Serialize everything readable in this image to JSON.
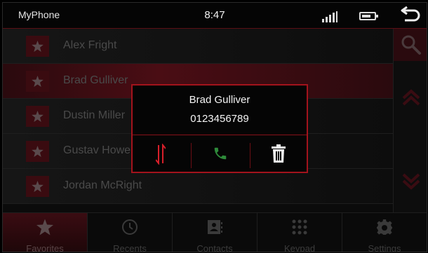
{
  "status": {
    "app_name": "MyPhone",
    "time": "8:47"
  },
  "contacts": [
    {
      "name": "Alex Fright"
    },
    {
      "name": "Brad Gulliver"
    },
    {
      "name": "Dustin Miller"
    },
    {
      "name": "Gustav Howe"
    },
    {
      "name": "Jordan McRight"
    }
  ],
  "dialog": {
    "name": "Brad Gulliver",
    "number": "0123456789"
  },
  "nav": [
    {
      "label": "Favorites",
      "icon": "star-icon"
    },
    {
      "label": "Recents",
      "icon": "clock-icon"
    },
    {
      "label": "Contacts",
      "icon": "contact-card-icon"
    },
    {
      "label": "Keypad",
      "icon": "keypad-icon"
    },
    {
      "label": "Settings",
      "icon": "gear-icon"
    }
  ],
  "colors": {
    "accent": "#a3131c",
    "call_green": "#2e8b3a",
    "background": "#0b0b0b"
  }
}
